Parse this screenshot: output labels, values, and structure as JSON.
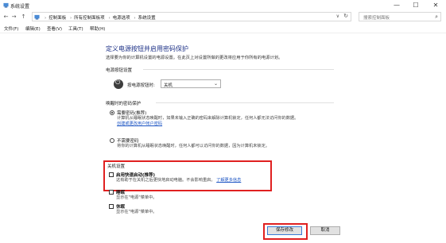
{
  "window": {
    "title": "系统设置",
    "min": "—",
    "max": "☐",
    "close": "✕"
  },
  "nav": {
    "back": "←",
    "forward": "→",
    "up": "↑",
    "dropdown": "∨",
    "refresh": "↻"
  },
  "breadcrumb": [
    "控制面板",
    "所有控制面板项",
    "电源选项",
    "系统设置"
  ],
  "search": {
    "placeholder": "搜索控制面板",
    "icon": "search-icon"
  },
  "menu": [
    "文件(F)",
    "编辑(E)",
    "查看(V)",
    "工具(T)",
    "帮助(H)"
  ],
  "page": {
    "title": "定义电源按钮并启用密码保护",
    "description": "选择要为你的计算机设置的电源设置。在此页上对设置所做的更改将应用于你所有的电源计划。"
  },
  "power_button": {
    "section": "电源按钮设置",
    "label": "按电源按钮时:",
    "value": "关机"
  },
  "wake_password": {
    "section": "唤醒时的密码保护",
    "require_title": "需要密码(推荐)",
    "require_desc": "计算机从睡眠状态唤醒时，如果未输入正确的密码来解除计算机锁定，任何人都无法访问你的数据。",
    "require_link": "创建或更改用户帐户密码",
    "no_title": "不需要密码",
    "no_desc": "将你的计算机从睡眠状态唤醒时，任何人都可以访问你的数据，因为计算机未锁定。"
  },
  "shutdown": {
    "section": "关机设置",
    "fast_title": "启用快速启动(推荐)",
    "fast_desc": "这有助于在关机之后更快地启动电脑。不会影响重启。",
    "fast_link": "了解更多信息",
    "sleep_title": "睡眠",
    "sleep_desc": "显示在\"电源\"菜单中。",
    "hibernate_title": "休眠",
    "hibernate_desc": "显示在\"电源\"菜单中。"
  },
  "buttons": {
    "save": "保存修改",
    "cancel": "取消"
  },
  "colors": {
    "title_blue": "#1e3287",
    "link_blue": "#1e56c4",
    "highlight_red": "#e02020"
  }
}
